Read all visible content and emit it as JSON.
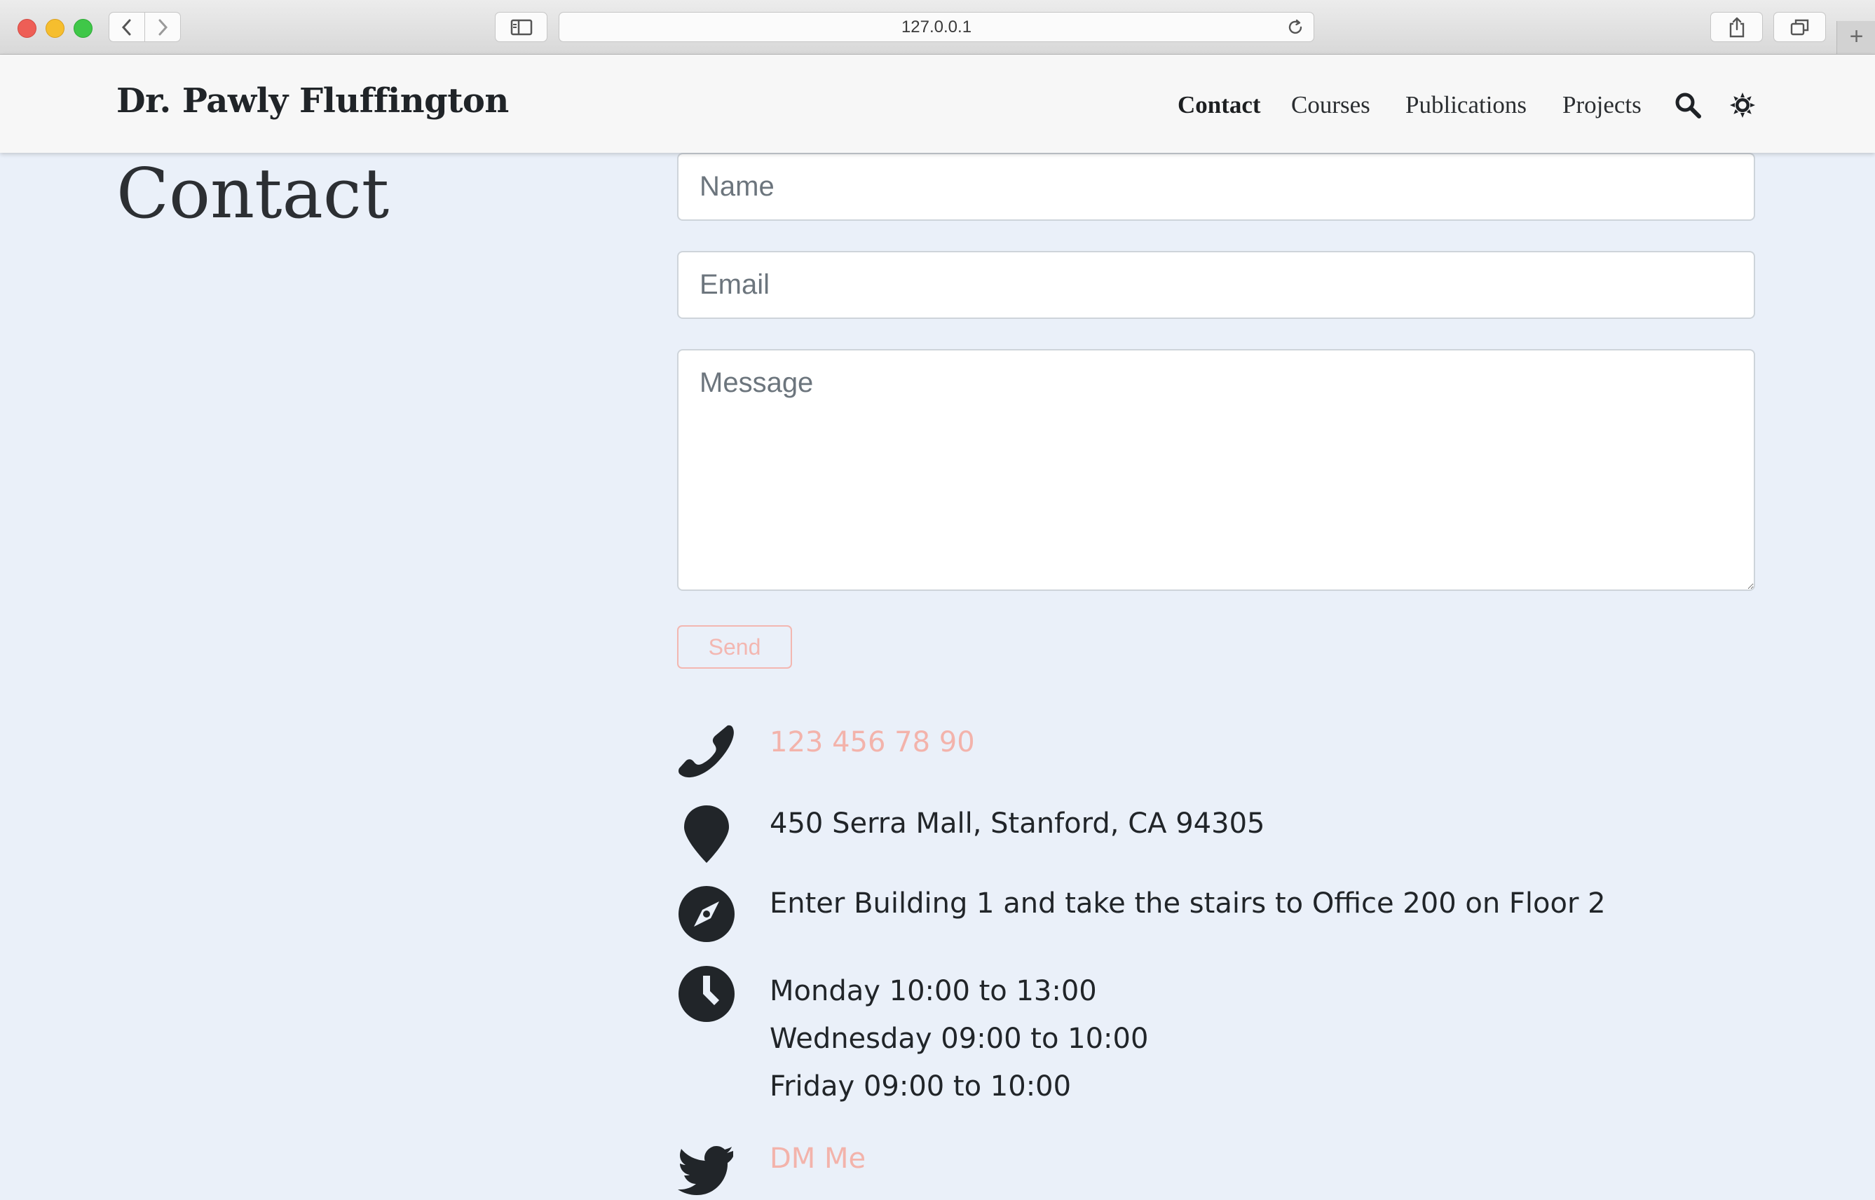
{
  "browser": {
    "url": "127.0.0.1",
    "new_tab_label": "+"
  },
  "header": {
    "brand": "Dr. Pawly Fluffington",
    "nav": {
      "contact": "Contact",
      "courses": "Courses",
      "publications": "Publications",
      "projects": "Projects"
    },
    "icons": [
      "search-icon",
      "theme-toggle-icon"
    ]
  },
  "page": {
    "title": "Contact"
  },
  "form": {
    "name_placeholder": "Name",
    "email_placeholder": "Email",
    "message_placeholder": "Message",
    "send_label": "Send"
  },
  "info": {
    "phone": "123 456 78 90",
    "address": "450 Serra Mall, Stanford, CA 94305",
    "directions": "Enter Building 1 and take the stairs to Office 200 on Floor 2",
    "hours": [
      "Monday 10:00 to 13:00",
      "Wednesday 09:00 to 10:00",
      "Friday 09:00 to 10:00"
    ],
    "twitter": "DM Me"
  },
  "colors": {
    "page_background": "#eaf0f9",
    "link_accent": "#f3b3ab",
    "text": "#212529"
  }
}
